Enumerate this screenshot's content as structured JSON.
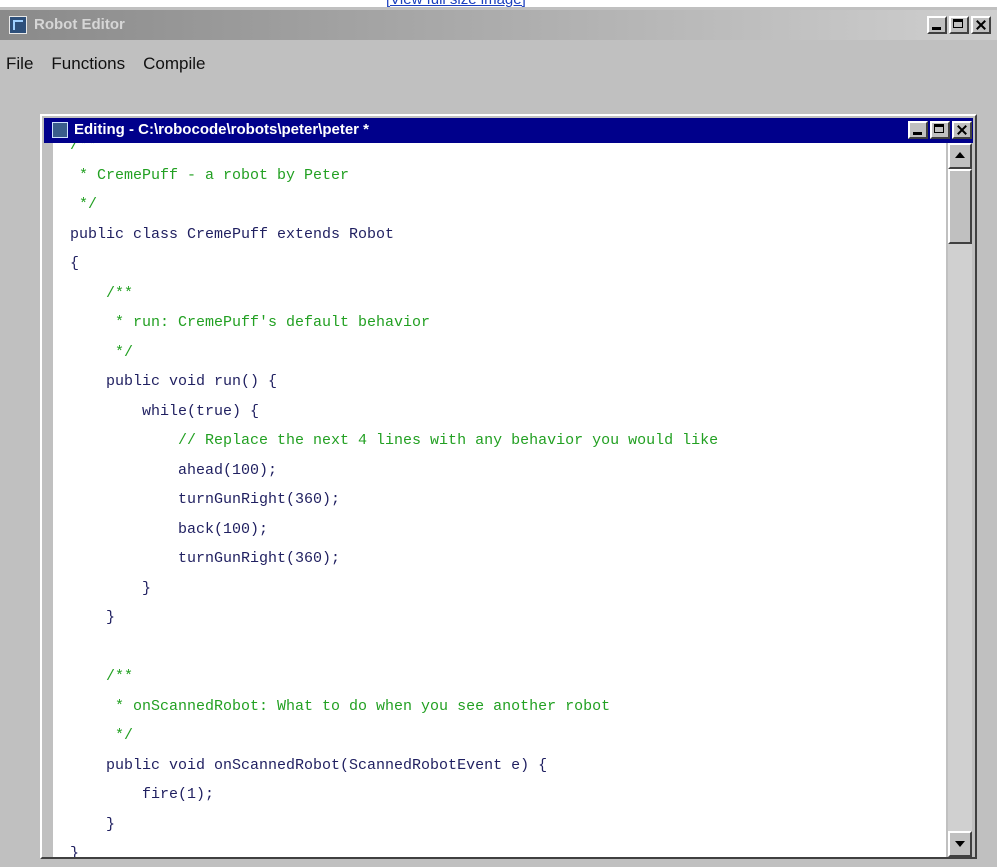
{
  "top_link": "[View full size image]",
  "app": {
    "title": "Robot Editor",
    "icon": "robot-editor-icon"
  },
  "menu": {
    "items": [
      "File",
      "Functions",
      "Compile"
    ]
  },
  "editor_window": {
    "title": "Editing - C:\\robocode\\robots\\peter\\peter *",
    "icon": "document-icon"
  },
  "code": [
    {
      "text": "/**",
      "kind": "comment"
    },
    {
      "text": " * CremePuff - a robot by Peter",
      "kind": "comment"
    },
    {
      "text": " */",
      "kind": "comment"
    },
    {
      "text": "public class CremePuff extends Robot",
      "kind": "code"
    },
    {
      "text": "{",
      "kind": "code"
    },
    {
      "text": "    /**",
      "kind": "comment"
    },
    {
      "text": "     * run: CremePuff's default behavior",
      "kind": "comment"
    },
    {
      "text": "     */",
      "kind": "comment"
    },
    {
      "text": "    public void run() {",
      "kind": "code"
    },
    {
      "text": "        while(true) {",
      "kind": "code"
    },
    {
      "text": "            // Replace the next 4 lines with any behavior you would like",
      "kind": "comment"
    },
    {
      "text": "            ahead(100);",
      "kind": "code"
    },
    {
      "text": "            turnGunRight(360);",
      "kind": "code"
    },
    {
      "text": "            back(100);",
      "kind": "code"
    },
    {
      "text": "            turnGunRight(360);",
      "kind": "code"
    },
    {
      "text": "        }",
      "kind": "code"
    },
    {
      "text": "    }",
      "kind": "code"
    },
    {
      "text": "",
      "kind": "code"
    },
    {
      "text": "    /**",
      "kind": "comment"
    },
    {
      "text": "     * onScannedRobot: What to do when you see another robot",
      "kind": "comment"
    },
    {
      "text": "     */",
      "kind": "comment"
    },
    {
      "text": "    public void onScannedRobot(ScannedRobotEvent e) {",
      "kind": "code"
    },
    {
      "text": "        fire(1);",
      "kind": "code"
    },
    {
      "text": "    }",
      "kind": "code"
    },
    {
      "text": "}",
      "kind": "code"
    }
  ],
  "colors": {
    "comment": "#22a022",
    "code": "#1f1f60",
    "active_titlebar": "#00008b",
    "inactive_titlebar": "#a9a9a9"
  }
}
